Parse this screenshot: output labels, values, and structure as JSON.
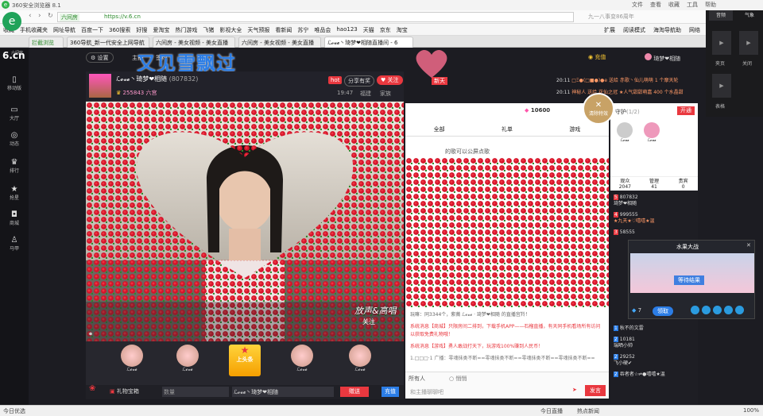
{
  "browser": {
    "title": "360安全浏览器 8.1",
    "address": "https://v.6.cn",
    "address_host_badge": "六间房",
    "search_hint": "九一八事变86周年",
    "menu": [
      "文件",
      "查看",
      "收藏",
      "工具",
      "帮助"
    ],
    "bookmarks": [
      "收藏",
      "手机收藏夹",
      "网址导航",
      "百度一下",
      "360搜索",
      "好搜",
      "爱淘宝",
      "热门游戏",
      "飞猪",
      "影视大全",
      "天气预报",
      "看新闻",
      "苏宁",
      "唯品会",
      "hao123",
      "天猫",
      "京东",
      "淘宝"
    ],
    "toolbar_right": [
      "扩展",
      "阅读模式",
      "海淘导航助",
      "网络"
    ],
    "tabs": [
      "拦截浏览",
      "360导航_新一代安全上网导航",
      "六间房 - 美女视频 - 美女直播",
      "六间房 - 美女视频 - 美女直播",
      "ℒ𝓸𝓿𝓮丶琦梦❤相随直播间 - 6"
    ],
    "status_left": "今日优选",
    "status_right": [
      "今日直播",
      "热点新闻",
      "100%"
    ]
  },
  "site": {
    "logo": "6.cn",
    "logo_sub": "六间房",
    "sidebar": [
      "移动版",
      "大厅",
      "动态",
      "排行",
      "抢星",
      "商城",
      "马甲"
    ],
    "nav": [
      "设置",
      "主播",
      "签约"
    ],
    "top_right": [
      "充值"
    ],
    "user_name": "琦梦❤相随",
    "banner_text": "又见雪飘过",
    "room": {
      "anchor_name": "ℒ𝓸𝓿𝓮丶琦梦❤相随",
      "room_id": "(807832)",
      "badge": "hot",
      "share": "分享有奖",
      "follow": "关注",
      "fans": "255843",
      "fans_label": "六宫",
      "time": "19:47",
      "location": "福建",
      "family": "家族"
    },
    "announcements": [
      {
        "time": "20:11",
        "text": "□Ξ●(□■●)●e 送给 赤歌丶仙儿萌萌 1 个摩天轮"
      },
      {
        "time": "20:11",
        "text": "神秘人 送给 花仙之冠 ★人气甜甜萌嘉 400 个水晶甜"
      }
    ],
    "room_tag": "新天",
    "gift_tip": "清除特效",
    "rank_score": "10600",
    "renew": "开通",
    "chat_tabs": [
      "全部",
      "礼单",
      "游戏"
    ],
    "chat_first_line": "的歌可以公屏点歌",
    "chat_lines": [
      "玩嘛：同3344个，紫薇 ℒ𝓸𝓿𝓮 · 琦梦❤相随 的直播宫羚！",
      "系统消息【商城】只限房间二排到，下载手机APP——石榴直播，有天同手机看场所有访问以获取免费礼物哦！",
      "系统消息【游戏】勇人敢战打天下，玩游戏100%赚到人民币！",
      "1.□□□·1 广播：零魂抹类不断==零魂抹类不断==零魂抹类不断==零魂抹类不断=="
    ],
    "chat_target": "所有人",
    "whisper": "悄悄",
    "chat_placeholder": "和主播聊聊吧",
    "send": "发言",
    "guard": {
      "title": "守护",
      "count": "(1/2)",
      "names": [
        "ℒ𝓸𝓿𝓮",
        "ℒ𝓸𝓿𝓮"
      ]
    },
    "audience": {
      "headers": [
        "观众",
        "管理",
        "贵宾"
      ],
      "values": [
        "2047",
        "41",
        "0"
      ]
    },
    "viewers": [
      {
        "level": "5",
        "name": "807832",
        "sub": "琦梦❤相随"
      },
      {
        "level": "4",
        "name": "999555",
        "sub": "★九天★♡嘻嘻★温"
      },
      {
        "level": "3",
        "name": "58555",
        "sub": ""
      },
      {
        "level": "2",
        "name": "10181",
        "sub": "瑞晒小帅"
      },
      {
        "level": "2",
        "name": "29252",
        "sub": "飞小硬✔"
      },
      {
        "level": "2",
        "name": "",
        "sub": "吞者者☆⇌●嘻嘻★温"
      },
      {
        "level": "1",
        "name": "",
        "sub": "秋不的文雷"
      }
    ],
    "popup": {
      "title": "水果大战",
      "button": "等待结果",
      "coins": "7",
      "btn2": "领取"
    },
    "gift_bottom": {
      "gift_box": "礼物宝箱",
      "count_placeholder": "数量",
      "recipient": "ℒ𝓸𝓿𝓮丶琦梦❤相随",
      "give": "赠送",
      "recharge": "充值",
      "hot_label": "上头条"
    },
    "gift_names": [
      "ℒ𝓸𝓿𝓮",
      "ℒ𝓸𝓿𝓮",
      "ℒ𝓸𝓿𝓮",
      "ℒ𝓸𝓿𝓮",
      "ℒ𝓸𝓿𝓮"
    ],
    "video_overlay": "放声&高唱",
    "video_overlay2": "关注"
  },
  "mini": {
    "labels": [
      "音频",
      "关闭",
      "夹页",
      "表格",
      "气象"
    ]
  },
  "colors": {
    "accent": "#e9383f",
    "brand_green": "#20a35a",
    "dark": "#1c1c22"
  }
}
